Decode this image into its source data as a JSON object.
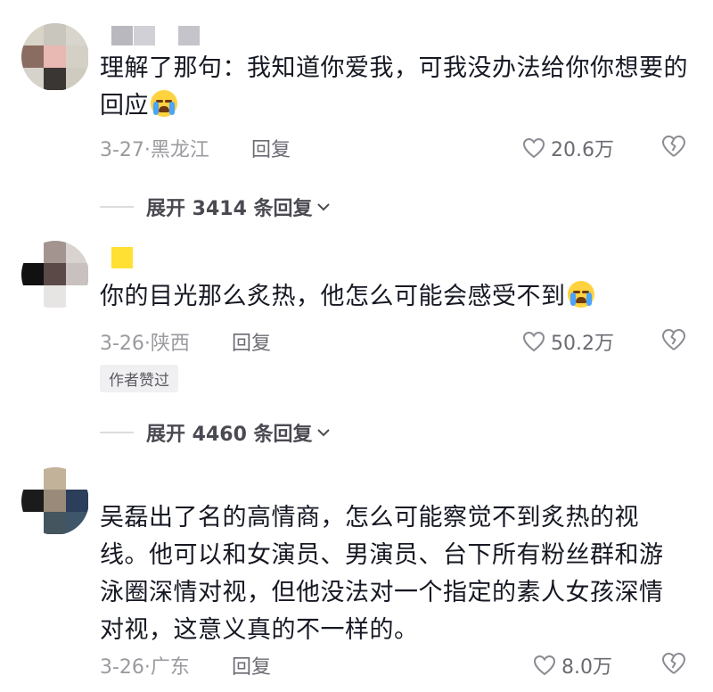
{
  "comments": [
    {
      "text": "理解了那句：我知道你爱我，可我没办法给你你想要的回应",
      "date_location": "3-27·黑龙江",
      "reply_label": "回复",
      "likes": "20.6万",
      "emoji": "crying-face",
      "expand_label": "展开 3414 条回复"
    },
    {
      "text": "你的目光那么炙热，他怎么可能会感受不到",
      "date_location": "3-26·陕西",
      "reply_label": "回复",
      "likes": "50.2万",
      "emoji": "crying-face",
      "badge": "作者赞过",
      "expand_label": "展开 4460 条回复"
    },
    {
      "text": "吴磊出了名的高情商，怎么可能察觉不到炙热的视线。他可以和女演员、男演员、台下所有粉丝群和游泳圈深情对视，但他没法对一个指定的素人女孩深情对视，这意义真的不一样的。",
      "date_location": "3-26·广东",
      "reply_label": "回复",
      "likes": "8.0万"
    }
  ],
  "colors": {
    "text": "#161823",
    "meta": "#9a9aa0",
    "name_bar_yellow": "#ffe033",
    "heart_outline": "#8a8a92"
  },
  "icons": [
    "heart-outline-icon",
    "broken-heart-icon",
    "chevron-down-icon",
    "crying-face-emoji"
  ]
}
